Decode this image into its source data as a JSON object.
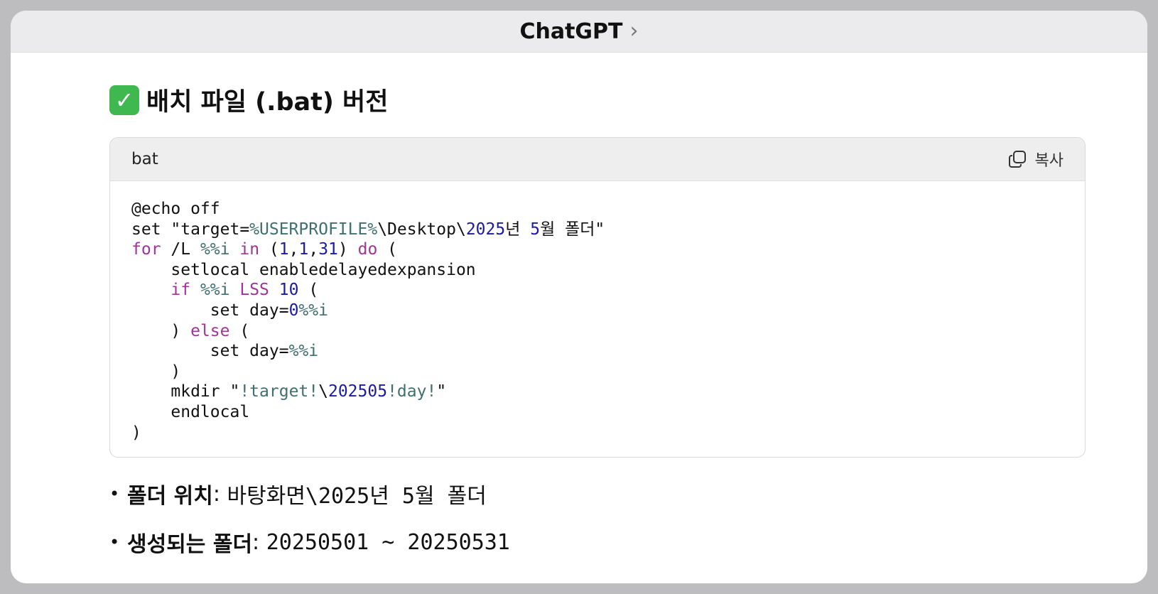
{
  "window": {
    "title": "ChatGPT"
  },
  "section": {
    "heading": "배치 파일 (.bat) 버전"
  },
  "code_block": {
    "language": "bat",
    "copy_label": "복사",
    "lines": [
      [
        {
          "t": "@echo off",
          "c": ""
        }
      ],
      [
        {
          "t": "set \"target=",
          "c": ""
        },
        {
          "t": "%USERPROFILE%",
          "c": "var"
        },
        {
          "t": "\\Desktop\\",
          "c": ""
        },
        {
          "t": "2025",
          "c": "num"
        },
        {
          "t": "년 ",
          "c": ""
        },
        {
          "t": "5",
          "c": "num"
        },
        {
          "t": "월 폴더\"",
          "c": ""
        }
      ],
      [
        {
          "t": "for",
          "c": "kw"
        },
        {
          "t": " /L ",
          "c": ""
        },
        {
          "t": "%%i",
          "c": "var"
        },
        {
          "t": " ",
          "c": ""
        },
        {
          "t": "in",
          "c": "kw"
        },
        {
          "t": " (",
          "c": ""
        },
        {
          "t": "1",
          "c": "num"
        },
        {
          "t": ",",
          "c": ""
        },
        {
          "t": "1",
          "c": "num"
        },
        {
          "t": ",",
          "c": ""
        },
        {
          "t": "31",
          "c": "num"
        },
        {
          "t": ") ",
          "c": ""
        },
        {
          "t": "do",
          "c": "kw"
        },
        {
          "t": " (",
          "c": ""
        }
      ],
      [
        {
          "t": "    setlocal enabledelayedexpansion",
          "c": ""
        }
      ],
      [
        {
          "t": "    ",
          "c": ""
        },
        {
          "t": "if",
          "c": "kw"
        },
        {
          "t": " ",
          "c": ""
        },
        {
          "t": "%%i",
          "c": "var"
        },
        {
          "t": " ",
          "c": ""
        },
        {
          "t": "LSS",
          "c": "kw"
        },
        {
          "t": " ",
          "c": ""
        },
        {
          "t": "10",
          "c": "num"
        },
        {
          "t": " (",
          "c": ""
        }
      ],
      [
        {
          "t": "        set day=",
          "c": ""
        },
        {
          "t": "0",
          "c": "num"
        },
        {
          "t": "%%i",
          "c": "var"
        }
      ],
      [
        {
          "t": "    ) ",
          "c": ""
        },
        {
          "t": "else",
          "c": "kw"
        },
        {
          "t": " (",
          "c": ""
        }
      ],
      [
        {
          "t": "        set day=",
          "c": ""
        },
        {
          "t": "%%i",
          "c": "var"
        }
      ],
      [
        {
          "t": "    )",
          "c": ""
        }
      ],
      [
        {
          "t": "    mkdir \"",
          "c": ""
        },
        {
          "t": "!target!",
          "c": "var"
        },
        {
          "t": "\\",
          "c": ""
        },
        {
          "t": "202505",
          "c": "num"
        },
        {
          "t": "!day!",
          "c": "var"
        },
        {
          "t": "\"",
          "c": ""
        }
      ],
      [
        {
          "t": "    endlocal",
          "c": ""
        }
      ],
      [
        {
          "t": ")",
          "c": ""
        }
      ]
    ]
  },
  "points": [
    {
      "label": "폴더 위치",
      "value": "바탕화면\\2025년 5월 폴더"
    },
    {
      "label": "생성되는 폴더",
      "value": "20250501 ~ 20250531"
    }
  ],
  "icons": {
    "heading": "check-mark-icon",
    "copy": "copy-icon",
    "title_chevron": "chevron-right-icon"
  },
  "colors": {
    "keyword": "#a3329a",
    "number": "#1a1aa6",
    "variable": "#3f6f6f",
    "check": "#3fb94f"
  }
}
